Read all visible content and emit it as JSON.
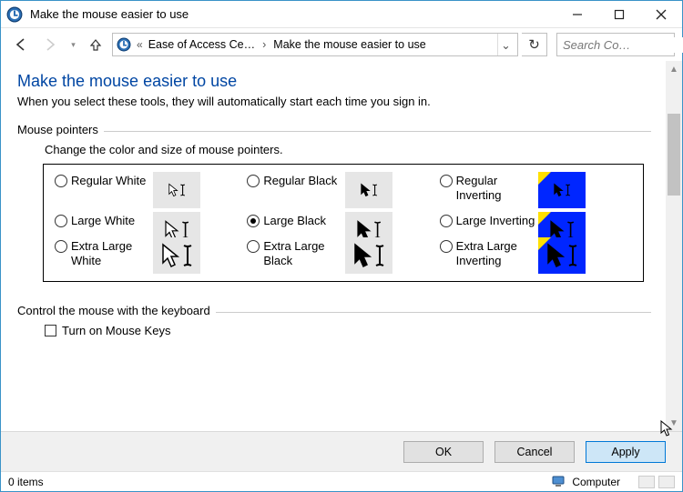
{
  "window": {
    "title": "Make the mouse easier to use"
  },
  "breadcrumb": {
    "seg1": "Ease of Access Ce…",
    "seg2": "Make the mouse easier to use"
  },
  "search": {
    "placeholder": "Search Co…"
  },
  "heading": "Make the mouse easier to use",
  "subheading": "When you select these tools, they will automatically start each time you sign in.",
  "section_pointers": {
    "title": "Mouse pointers",
    "desc": "Change the color and size of mouse pointers.",
    "options": [
      {
        "id": "reg-white",
        "label": "Regular White",
        "selected": false,
        "scheme": "white",
        "size": "s"
      },
      {
        "id": "reg-black",
        "label": "Regular Black",
        "selected": false,
        "scheme": "black",
        "size": "s"
      },
      {
        "id": "reg-inv",
        "label": "Regular Inverting",
        "selected": false,
        "scheme": "inv",
        "size": "s"
      },
      {
        "id": "lg-white",
        "label": "Large White",
        "selected": false,
        "scheme": "white",
        "size": "m"
      },
      {
        "id": "lg-black",
        "label": "Large Black",
        "selected": true,
        "scheme": "black",
        "size": "m"
      },
      {
        "id": "lg-inv",
        "label": "Large Inverting",
        "selected": false,
        "scheme": "inv",
        "size": "m"
      },
      {
        "id": "xl-white",
        "label": "Extra Large White",
        "selected": false,
        "scheme": "white",
        "size": "l"
      },
      {
        "id": "xl-black",
        "label": "Extra Large Black",
        "selected": false,
        "scheme": "black",
        "size": "l"
      },
      {
        "id": "xl-inv",
        "label": "Extra Large Inverting",
        "selected": false,
        "scheme": "inv",
        "size": "l"
      }
    ]
  },
  "section_keys": {
    "title": "Control the mouse with the keyboard",
    "check1": "Turn on Mouse Keys"
  },
  "buttons": {
    "ok": "OK",
    "cancel": "Cancel",
    "apply": "Apply"
  },
  "statusbar": {
    "left": "0 items",
    "right": "Computer"
  }
}
